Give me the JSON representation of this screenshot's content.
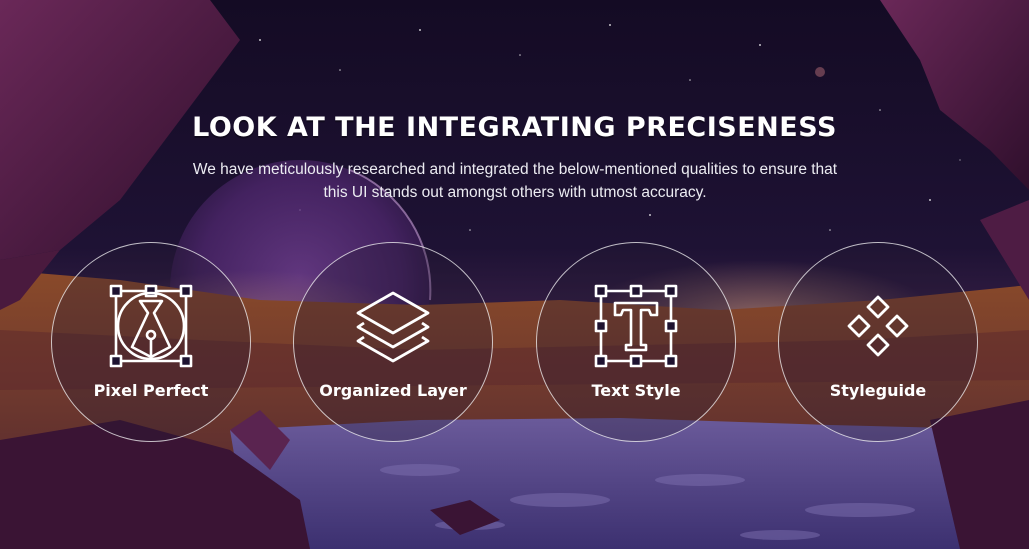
{
  "header": {
    "title": "LOOK AT THE INTEGRATING PRECISENESS",
    "subtitle": "We have meticulously researched and integrated the below-mentioned qualities to ensure that this UI stands out amongst others with utmost accuracy."
  },
  "features": [
    {
      "label": "Pixel Perfect",
      "icon": "pen-tool-icon"
    },
    {
      "label": "Organized Layer",
      "icon": "layers-icon"
    },
    {
      "label": "Text Style",
      "icon": "text-style-icon"
    },
    {
      "label": "Styleguide",
      "icon": "styleguide-icon"
    }
  ],
  "colors": {
    "sky": "#1c1030",
    "rock": "#5a1f4a",
    "ground": "#7a3a28",
    "lake": "#4a3f7a",
    "text": "#ffffff"
  }
}
